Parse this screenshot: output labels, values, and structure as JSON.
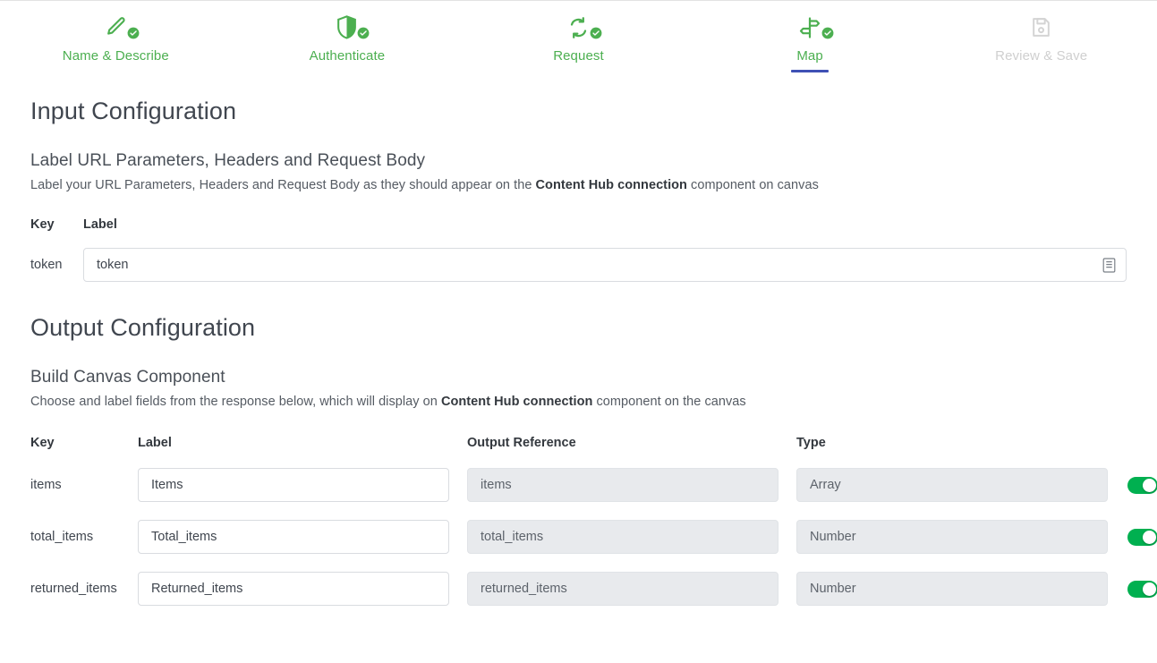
{
  "stepper": {
    "steps": [
      {
        "id": "name-describe",
        "label": "Name & Describe",
        "state": "done",
        "icon": "pencil-icon"
      },
      {
        "id": "authenticate",
        "label": "Authenticate",
        "state": "done",
        "icon": "shield-icon"
      },
      {
        "id": "request",
        "label": "Request",
        "state": "done",
        "icon": "sync-arrows-icon"
      },
      {
        "id": "map",
        "label": "Map",
        "state": "active",
        "icon": "signpost-icon"
      },
      {
        "id": "review-save",
        "label": "Review & Save",
        "state": "disabled",
        "icon": "save-icon"
      }
    ]
  },
  "input_configuration": {
    "title": "Input Configuration",
    "subtitle": "Label URL Parameters, Headers and Request Body",
    "helper_prefix": "Label your URL Parameters, Headers and Request Body as they should appear on the ",
    "helper_bold": "Content Hub connection",
    "helper_suffix": " component on canvas",
    "columns": {
      "key": "Key",
      "label": "Label"
    },
    "rows": [
      {
        "key": "token",
        "label_value": "token",
        "label_placeholder": "token",
        "field_icon": "reference-picker-icon"
      }
    ]
  },
  "output_configuration": {
    "title": "Output Configuration",
    "subtitle": "Build Canvas Component",
    "helper_prefix": "Choose and label fields from the response below, which will display on ",
    "helper_bold": "Content Hub connection",
    "helper_suffix": " component on the canvas",
    "columns": {
      "key": "Key",
      "label": "Label",
      "output_reference": "Output Reference",
      "type": "Type"
    },
    "rows": [
      {
        "key": "items",
        "label_value": "Items",
        "output_reference": "items",
        "type": "Array",
        "enabled": true
      },
      {
        "key": "total_items",
        "label_value": "Total_items",
        "output_reference": "total_items",
        "type": "Number",
        "enabled": true
      },
      {
        "key": "returned_items",
        "label_value": "Returned_items",
        "output_reference": "returned_items",
        "type": "Number",
        "enabled": true
      }
    ]
  },
  "colors": {
    "step_done": "#4caf50",
    "step_disabled": "#cfcfcf",
    "active_underline": "#3f51b5",
    "toggle_on": "#00b050",
    "heading": "#40464f",
    "readonly_field_bg": "#e8eaed"
  }
}
